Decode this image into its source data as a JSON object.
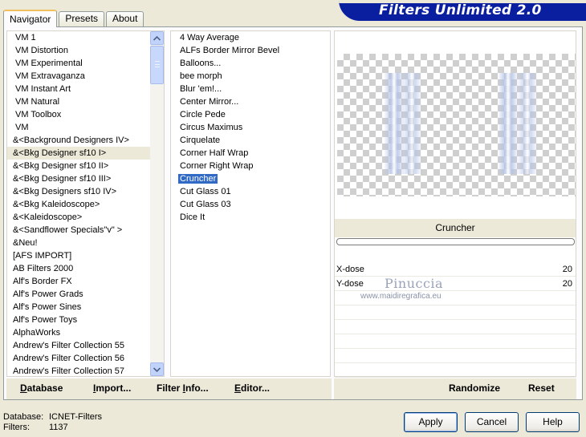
{
  "tabs": [
    "Navigator",
    "Presets",
    "About"
  ],
  "banner_title": "Filters Unlimited 2.0",
  "categories": [
    "VM 1",
    "VM Distortion",
    "VM Experimental",
    "VM Extravaganza",
    "VM Instant Art",
    "VM Natural",
    "VM Toolbox",
    "VM",
    "&<Background Designers IV>",
    "&<Bkg Designer sf10 I>",
    "&<Bkg Designer sf10 II>",
    "&<Bkg Designer sf10 III>",
    "&<Bkg Designers sf10 IV>",
    "&<Bkg Kaleidoscope>",
    "&<Kaleidoscope>",
    "&<Sandflower Specials\"v\" >",
    "&Neu!",
    "[AFS IMPORT]",
    "AB Filters 2000",
    "Alf's Border FX",
    "Alf's Power Grads",
    "Alf's Power Sines",
    "Alf's Power Toys",
    "AlphaWorks",
    "Andrew's Filter Collection 55",
    "Andrew's Filter Collection 56",
    "Andrew's Filter Collection 57"
  ],
  "selected_category": "&<Bkg Designer sf10 I>",
  "filters": [
    "4 Way Average",
    "ALFs Border Mirror Bevel",
    "Balloons...",
    "bee morph",
    "Blur 'em!...",
    "Center Mirror...",
    "Circle Pede",
    "Circus Maximus",
    "Cirquelate",
    "Corner Half Wrap",
    "Corner Right Wrap",
    "Cruncher",
    "Cut Glass 01",
    "Cut Glass 03",
    "Dice It"
  ],
  "selected_filter": "Cruncher",
  "preview": {
    "filter_name": "Cruncher",
    "params": [
      {
        "label": "X-dose",
        "value": "20"
      },
      {
        "label": "Y-dose",
        "value": "20"
      }
    ]
  },
  "watermark": {
    "name": "Pinuccia",
    "url": "www.maidiregrafica.eu"
  },
  "toolbar": {
    "database": {
      "u": "D",
      "rest": "atabase"
    },
    "import": {
      "u": "I",
      "rest": "mport..."
    },
    "filter_info": {
      "pre": "Filter ",
      "u": "I",
      "rest": "nfo..."
    },
    "editor": {
      "u": "E",
      "rest": "ditor..."
    },
    "randomize": "Randomize",
    "reset": "Reset"
  },
  "status": {
    "database_label": "Database:",
    "database_value": "ICNET-Filters",
    "filters_label": "Filters:",
    "filters_value": "1137"
  },
  "buttons": {
    "apply": "Apply",
    "cancel": "Cancel",
    "help": "Help"
  },
  "colors": {
    "banner": "#0a1fa0",
    "selection": "#316ac5",
    "window_bg": "#ece9d8"
  }
}
